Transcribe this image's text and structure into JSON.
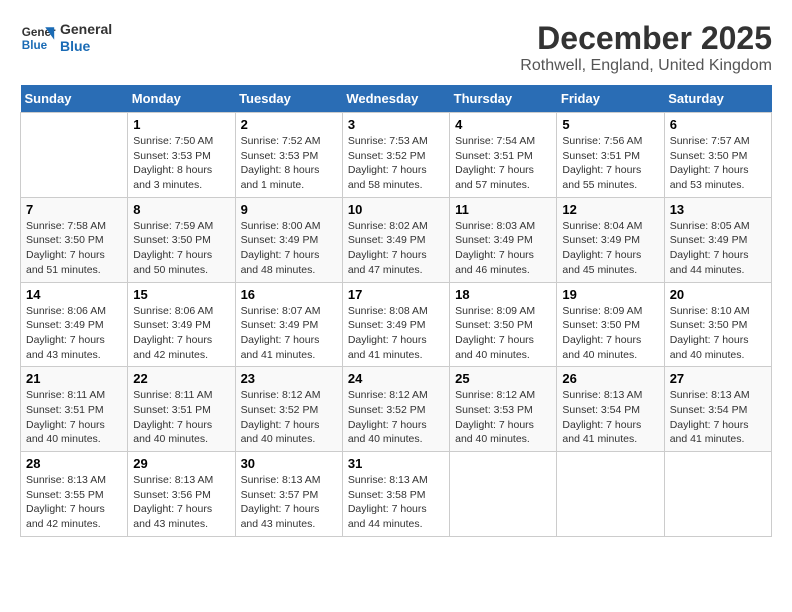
{
  "logo": {
    "line1": "General",
    "line2": "Blue"
  },
  "title": "December 2025",
  "subtitle": "Rothwell, England, United Kingdom",
  "days_header": [
    "Sunday",
    "Monday",
    "Tuesday",
    "Wednesday",
    "Thursday",
    "Friday",
    "Saturday"
  ],
  "weeks": [
    [
      {
        "num": "",
        "info": ""
      },
      {
        "num": "1",
        "info": "Sunrise: 7:50 AM\nSunset: 3:53 PM\nDaylight: 8 hours\nand 3 minutes."
      },
      {
        "num": "2",
        "info": "Sunrise: 7:52 AM\nSunset: 3:53 PM\nDaylight: 8 hours\nand 1 minute."
      },
      {
        "num": "3",
        "info": "Sunrise: 7:53 AM\nSunset: 3:52 PM\nDaylight: 7 hours\nand 58 minutes."
      },
      {
        "num": "4",
        "info": "Sunrise: 7:54 AM\nSunset: 3:51 PM\nDaylight: 7 hours\nand 57 minutes."
      },
      {
        "num": "5",
        "info": "Sunrise: 7:56 AM\nSunset: 3:51 PM\nDaylight: 7 hours\nand 55 minutes."
      },
      {
        "num": "6",
        "info": "Sunrise: 7:57 AM\nSunset: 3:50 PM\nDaylight: 7 hours\nand 53 minutes."
      }
    ],
    [
      {
        "num": "7",
        "info": "Sunrise: 7:58 AM\nSunset: 3:50 PM\nDaylight: 7 hours\nand 51 minutes."
      },
      {
        "num": "8",
        "info": "Sunrise: 7:59 AM\nSunset: 3:50 PM\nDaylight: 7 hours\nand 50 minutes."
      },
      {
        "num": "9",
        "info": "Sunrise: 8:00 AM\nSunset: 3:49 PM\nDaylight: 7 hours\nand 48 minutes."
      },
      {
        "num": "10",
        "info": "Sunrise: 8:02 AM\nSunset: 3:49 PM\nDaylight: 7 hours\nand 47 minutes."
      },
      {
        "num": "11",
        "info": "Sunrise: 8:03 AM\nSunset: 3:49 PM\nDaylight: 7 hours\nand 46 minutes."
      },
      {
        "num": "12",
        "info": "Sunrise: 8:04 AM\nSunset: 3:49 PM\nDaylight: 7 hours\nand 45 minutes."
      },
      {
        "num": "13",
        "info": "Sunrise: 8:05 AM\nSunset: 3:49 PM\nDaylight: 7 hours\nand 44 minutes."
      }
    ],
    [
      {
        "num": "14",
        "info": "Sunrise: 8:06 AM\nSunset: 3:49 PM\nDaylight: 7 hours\nand 43 minutes."
      },
      {
        "num": "15",
        "info": "Sunrise: 8:06 AM\nSunset: 3:49 PM\nDaylight: 7 hours\nand 42 minutes."
      },
      {
        "num": "16",
        "info": "Sunrise: 8:07 AM\nSunset: 3:49 PM\nDaylight: 7 hours\nand 41 minutes."
      },
      {
        "num": "17",
        "info": "Sunrise: 8:08 AM\nSunset: 3:49 PM\nDaylight: 7 hours\nand 41 minutes."
      },
      {
        "num": "18",
        "info": "Sunrise: 8:09 AM\nSunset: 3:50 PM\nDaylight: 7 hours\nand 40 minutes."
      },
      {
        "num": "19",
        "info": "Sunrise: 8:09 AM\nSunset: 3:50 PM\nDaylight: 7 hours\nand 40 minutes."
      },
      {
        "num": "20",
        "info": "Sunrise: 8:10 AM\nSunset: 3:50 PM\nDaylight: 7 hours\nand 40 minutes."
      }
    ],
    [
      {
        "num": "21",
        "info": "Sunrise: 8:11 AM\nSunset: 3:51 PM\nDaylight: 7 hours\nand 40 minutes."
      },
      {
        "num": "22",
        "info": "Sunrise: 8:11 AM\nSunset: 3:51 PM\nDaylight: 7 hours\nand 40 minutes."
      },
      {
        "num": "23",
        "info": "Sunrise: 8:12 AM\nSunset: 3:52 PM\nDaylight: 7 hours\nand 40 minutes."
      },
      {
        "num": "24",
        "info": "Sunrise: 8:12 AM\nSunset: 3:52 PM\nDaylight: 7 hours\nand 40 minutes."
      },
      {
        "num": "25",
        "info": "Sunrise: 8:12 AM\nSunset: 3:53 PM\nDaylight: 7 hours\nand 40 minutes."
      },
      {
        "num": "26",
        "info": "Sunrise: 8:13 AM\nSunset: 3:54 PM\nDaylight: 7 hours\nand 41 minutes."
      },
      {
        "num": "27",
        "info": "Sunrise: 8:13 AM\nSunset: 3:54 PM\nDaylight: 7 hours\nand 41 minutes."
      }
    ],
    [
      {
        "num": "28",
        "info": "Sunrise: 8:13 AM\nSunset: 3:55 PM\nDaylight: 7 hours\nand 42 minutes."
      },
      {
        "num": "29",
        "info": "Sunrise: 8:13 AM\nSunset: 3:56 PM\nDaylight: 7 hours\nand 43 minutes."
      },
      {
        "num": "30",
        "info": "Sunrise: 8:13 AM\nSunset: 3:57 PM\nDaylight: 7 hours\nand 43 minutes."
      },
      {
        "num": "31",
        "info": "Sunrise: 8:13 AM\nSunset: 3:58 PM\nDaylight: 7 hours\nand 44 minutes."
      },
      {
        "num": "",
        "info": ""
      },
      {
        "num": "",
        "info": ""
      },
      {
        "num": "",
        "info": ""
      }
    ]
  ]
}
